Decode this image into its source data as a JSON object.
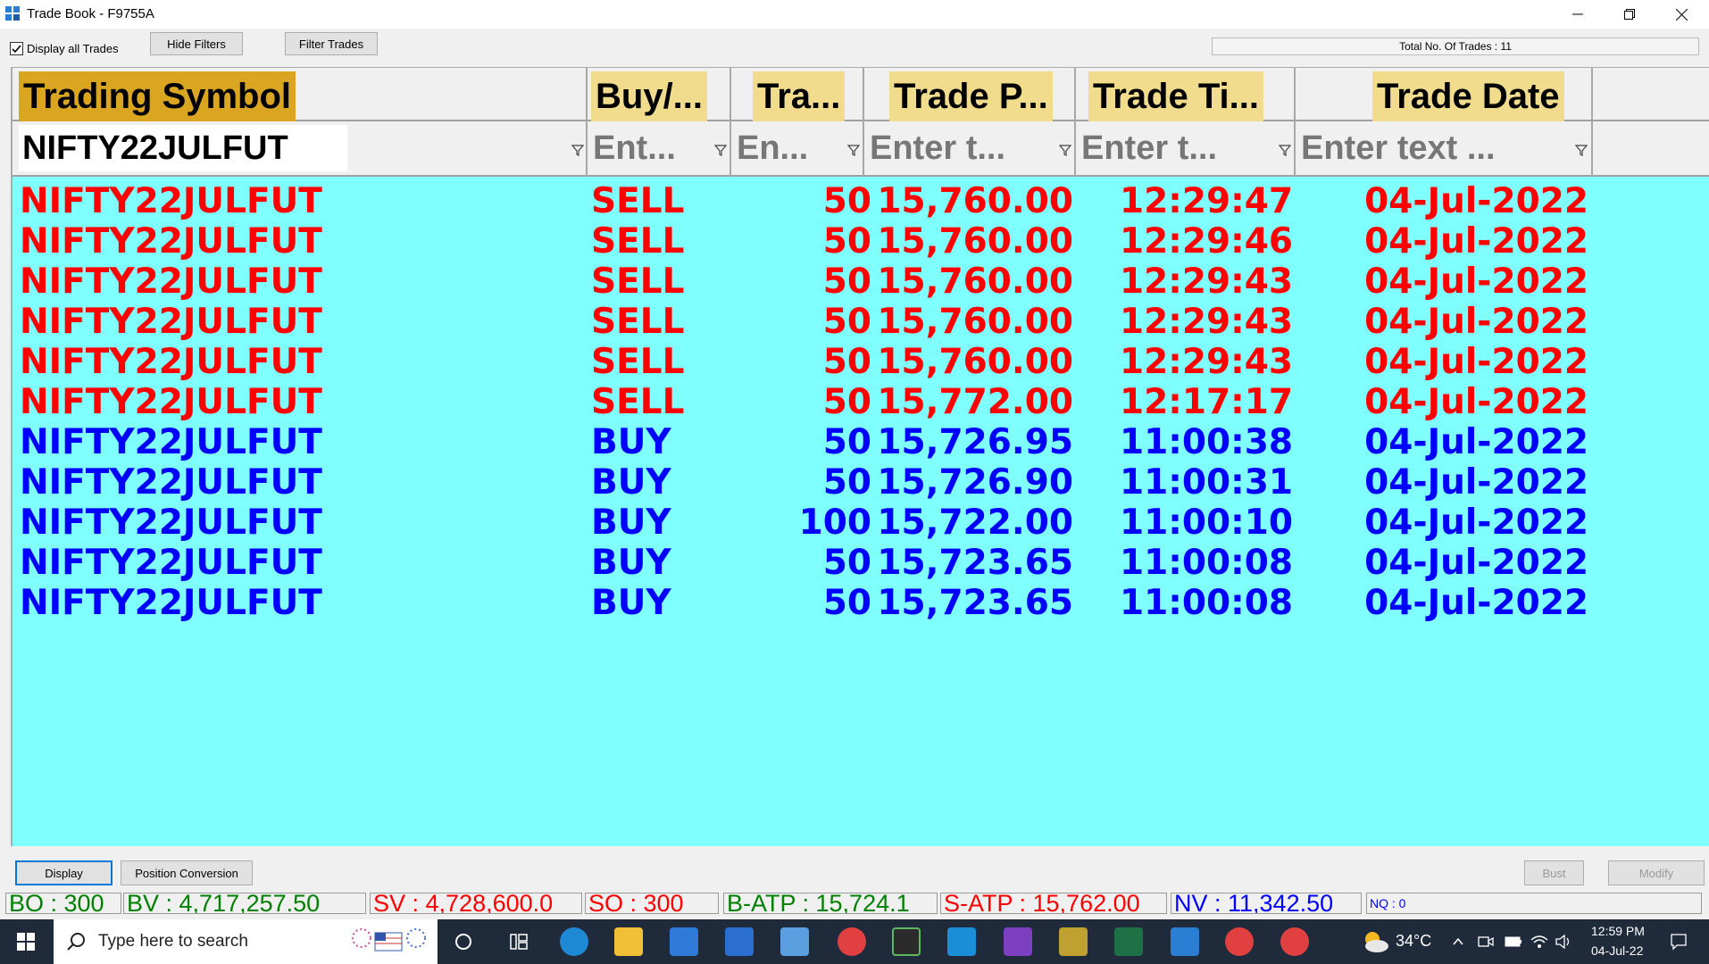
{
  "window": {
    "title": "Trade Book - F9755A"
  },
  "toolbar": {
    "display_all_label": "Display all Trades",
    "hide_filters_label": "Hide Filters",
    "filter_trades_label": "Filter Trades",
    "total_trades_text": "Total No. Of Trades : 11"
  },
  "grid": {
    "headers": [
      "Trading Symbol",
      "Buy/...",
      "Tra...",
      "Trade P...",
      "Trade Ti...",
      "Trade Date"
    ],
    "filters": {
      "symbol_value": "NIFTY22JULFUT",
      "buysell_placeholder": "Ent...",
      "qty_placeholder": "En...",
      "price_placeholder": "Enter t...",
      "time_placeholder": "Enter t...",
      "date_placeholder": "Enter text ..."
    },
    "rows": [
      {
        "symbol": "NIFTY22JULFUT",
        "side": "SELL",
        "qty": "50",
        "price": "15,760.00",
        "time": "12:29:47",
        "date": "04-Jul-2022"
      },
      {
        "symbol": "NIFTY22JULFUT",
        "side": "SELL",
        "qty": "50",
        "price": "15,760.00",
        "time": "12:29:46",
        "date": "04-Jul-2022"
      },
      {
        "symbol": "NIFTY22JULFUT",
        "side": "SELL",
        "qty": "50",
        "price": "15,760.00",
        "time": "12:29:43",
        "date": "04-Jul-2022"
      },
      {
        "symbol": "NIFTY22JULFUT",
        "side": "SELL",
        "qty": "50",
        "price": "15,760.00",
        "time": "12:29:43",
        "date": "04-Jul-2022"
      },
      {
        "symbol": "NIFTY22JULFUT",
        "side": "SELL",
        "qty": "50",
        "price": "15,760.00",
        "time": "12:29:43",
        "date": "04-Jul-2022"
      },
      {
        "symbol": "NIFTY22JULFUT",
        "side": "SELL",
        "qty": "50",
        "price": "15,772.00",
        "time": "12:17:17",
        "date": "04-Jul-2022"
      },
      {
        "symbol": "NIFTY22JULFUT",
        "side": "BUY",
        "qty": "50",
        "price": "15,726.95",
        "time": "11:00:38",
        "date": "04-Jul-2022"
      },
      {
        "symbol": "NIFTY22JULFUT",
        "side": "BUY",
        "qty": "50",
        "price": "15,726.90",
        "time": "11:00:31",
        "date": "04-Jul-2022"
      },
      {
        "symbol": "NIFTY22JULFUT",
        "side": "BUY",
        "qty": "100",
        "price": "15,722.00",
        "time": "11:00:10",
        "date": "04-Jul-2022"
      },
      {
        "symbol": "NIFTY22JULFUT",
        "side": "BUY",
        "qty": "50",
        "price": "15,723.65",
        "time": "11:00:08",
        "date": "04-Jul-2022"
      },
      {
        "symbol": "NIFTY22JULFUT",
        "side": "BUY",
        "qty": "50",
        "price": "15,723.65",
        "time": "11:00:08",
        "date": "04-Jul-2022"
      }
    ]
  },
  "bottom": {
    "display_label": "Display",
    "position_conversion_label": "Position Conversion",
    "bust_label": "Bust",
    "modify_label": "Modify"
  },
  "status": {
    "bo": "BO : 300",
    "bv": "BV : 4,717,257.50",
    "sv": "SV : 4,728,600.0",
    "so": "SO : 300",
    "batp": "B-ATP : 15,724.1",
    "satp": "S-ATP : 15,762.00",
    "nv": "NV : 11,342.50",
    "nq": "NQ : 0"
  },
  "taskbar": {
    "search_placeholder": "Type here to search",
    "temperature": "34°C",
    "time": "12:59 PM",
    "date": "04-Jul-22"
  },
  "colors": {
    "sell": "#ff0000",
    "buy": "#0000ff",
    "grid_bg": "#80ffff",
    "header_symbol_bg": "#daa520",
    "header_bg": "#f0dc8c",
    "status_green": "#008000",
    "status_red": "#ff0000",
    "status_blue": "#0000ff"
  }
}
